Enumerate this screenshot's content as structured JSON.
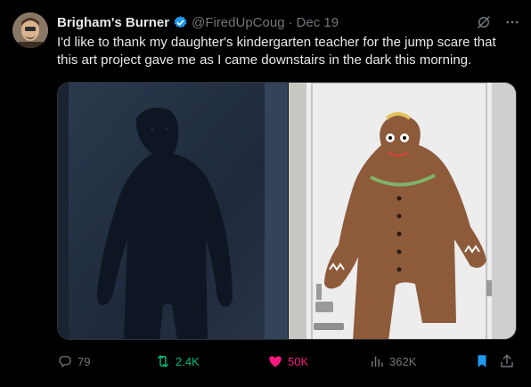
{
  "tweet": {
    "author_name": "Brigham's Burner",
    "handle": "@FiredUpCoug",
    "separator": "·",
    "date": "Dec 19",
    "text": "I'd like to thank my daughter's kindergarten teacher for the jump scare that this art project gave me as I came downstairs in the dark this morning."
  },
  "actions": {
    "replies": "79",
    "retweets": "2.4K",
    "likes": "50K",
    "views": "362K"
  },
  "icons": {
    "verified": "verified-badge-icon",
    "grok": "grok-icon",
    "more": "more-icon",
    "reply": "reply-icon",
    "retweet": "retweet-icon",
    "like": "heart-icon",
    "views": "views-icon",
    "bookmark": "bookmark-icon",
    "share": "share-icon"
  },
  "colors": {
    "background": "#000000",
    "text": "#e7e9ea",
    "muted": "#71767b",
    "verified": "#1d9bf0",
    "retweet_active": "#00ba7c",
    "like_active": "#f91880",
    "bookmark_active": "#1d9bf0"
  }
}
